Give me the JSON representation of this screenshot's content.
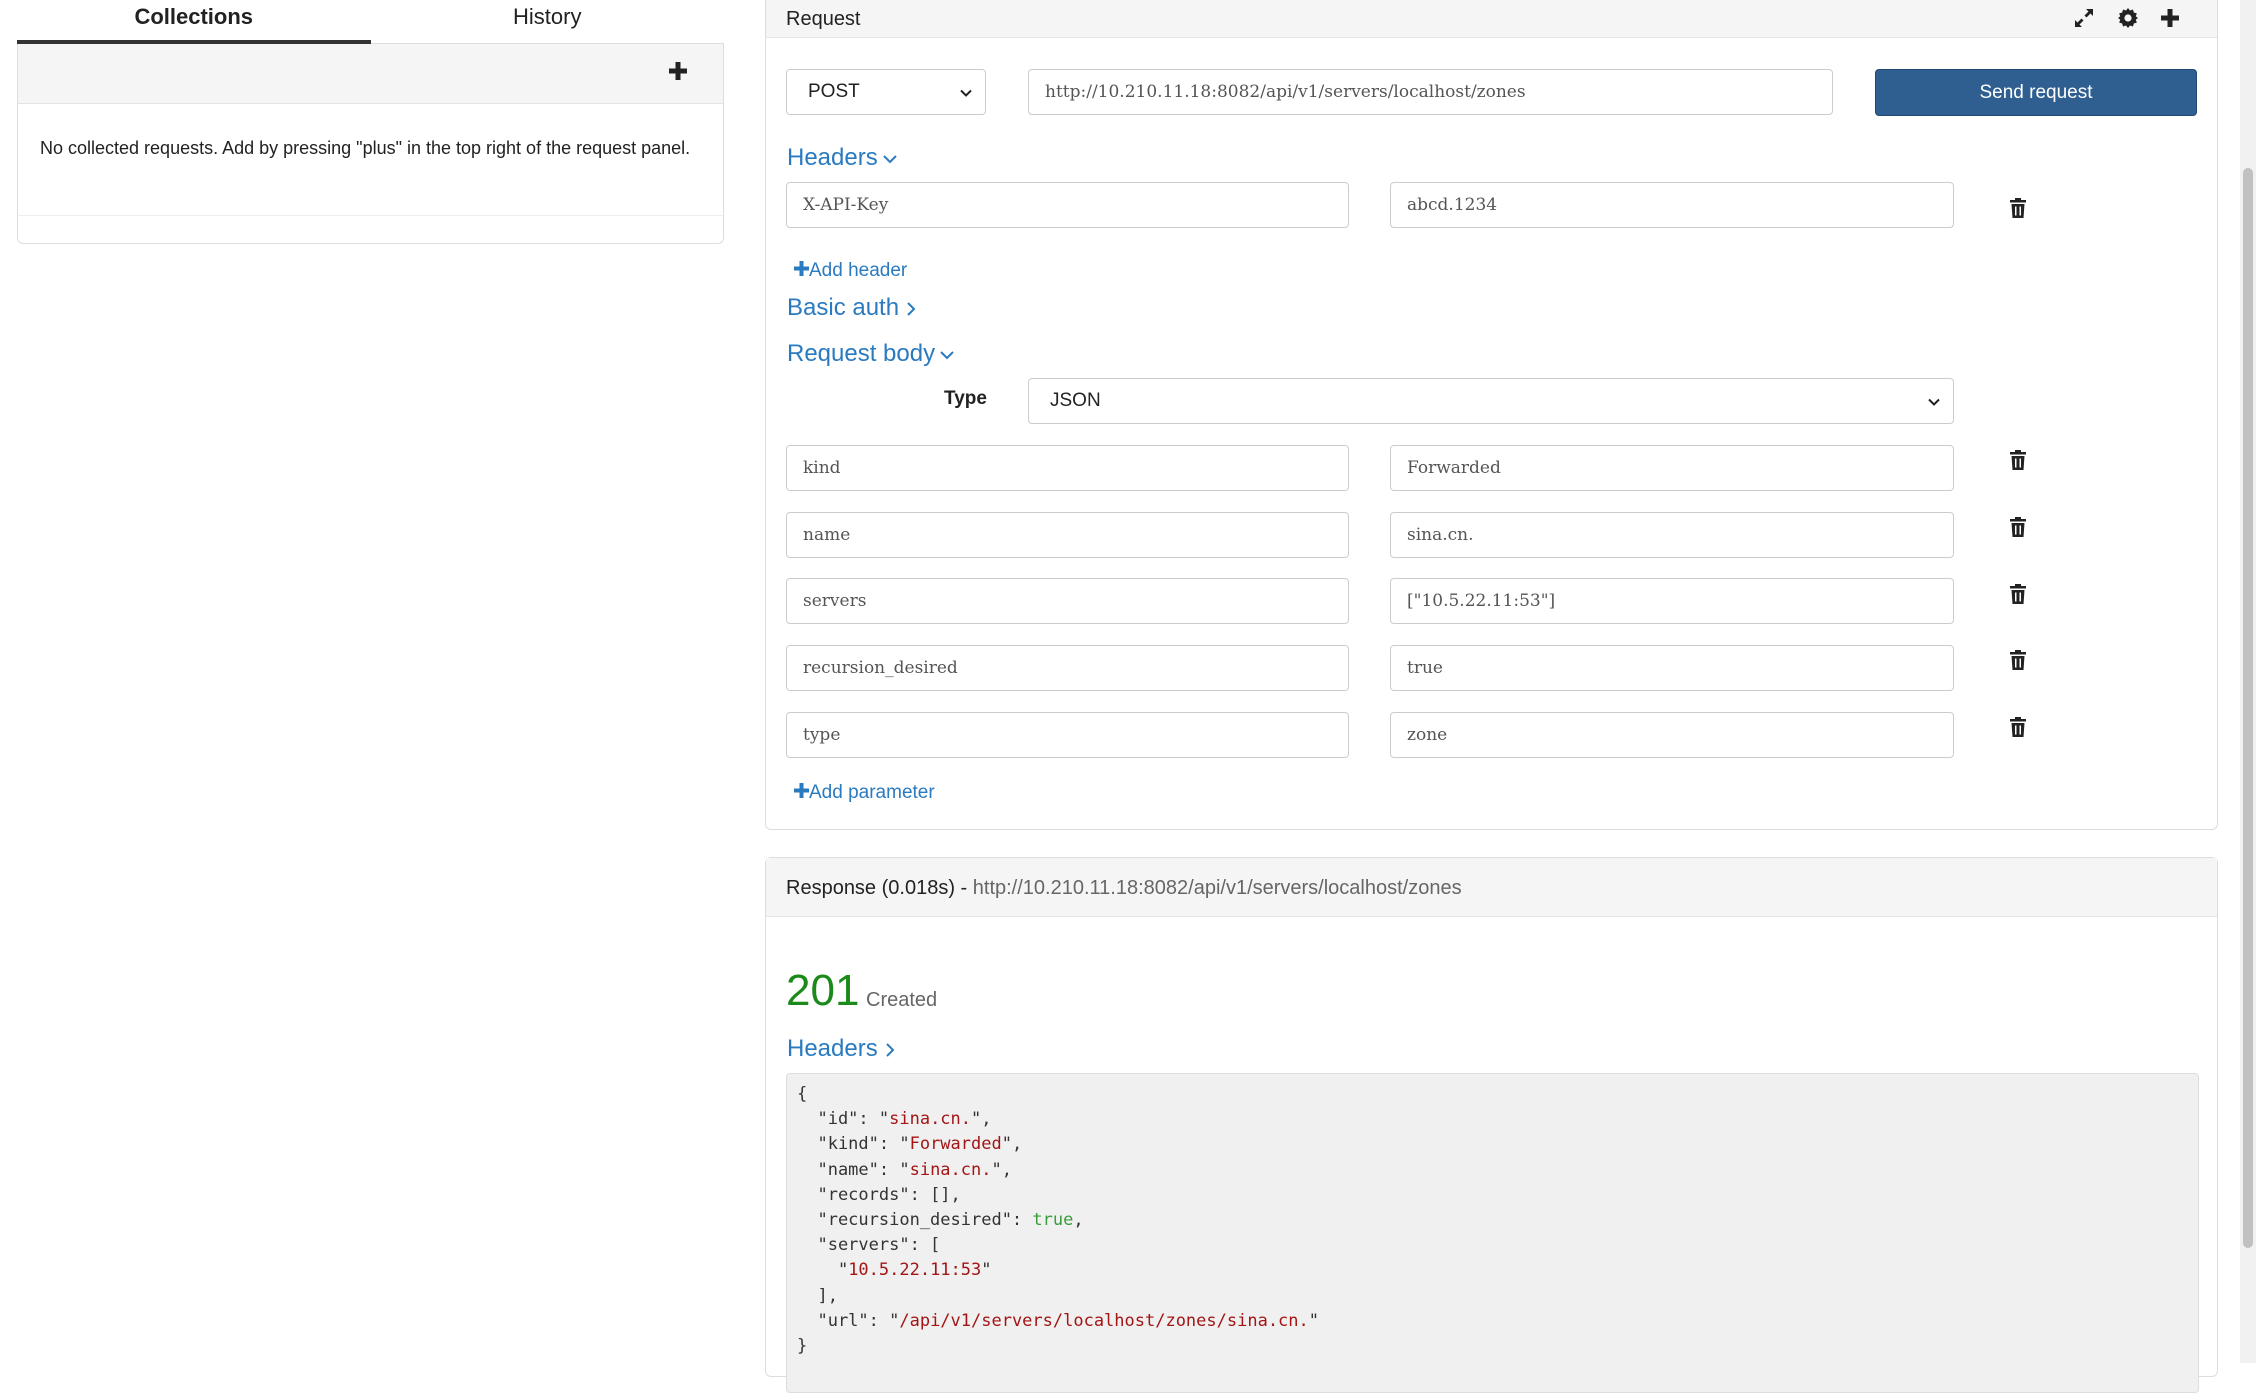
{
  "left": {
    "tabs": [
      "Collections",
      "History"
    ],
    "empty_message": "No collected requests. Add by pressing \"plus\" in the top right of the request panel."
  },
  "request": {
    "title": "Request",
    "method": "POST",
    "url": "http://10.210.11.18:8082/api/v1/servers/localhost/zones",
    "send_label": "Send request",
    "headers_title": "Headers",
    "headers": [
      {
        "key": "X-API-Key",
        "value": "abcd.1234"
      }
    ],
    "add_header_label": "Add header",
    "basic_auth_title": "Basic auth",
    "body_title": "Request body",
    "type_label": "Type",
    "type_value": "JSON",
    "params": [
      {
        "key": "kind",
        "value": "Forwarded"
      },
      {
        "key": "name",
        "value": "sina.cn."
      },
      {
        "key": "servers",
        "value": "[\"10.5.22.11:53\"]"
      },
      {
        "key": "recursion_desired",
        "value": "true"
      },
      {
        "key": "type",
        "value": "zone"
      }
    ],
    "add_param_label": "Add parameter"
  },
  "response": {
    "label": "Response (0.018s) -",
    "url": "http://10.210.11.18:8082/api/v1/servers/localhost/zones",
    "status_code": "201",
    "status_text": "Created",
    "headers_title": "Headers",
    "body": {
      "id": "sina.cn.",
      "kind": "Forwarded",
      "name": "sina.cn.",
      "records": "[]",
      "recursion_desired": "true",
      "server_0": "10.5.22.11:53",
      "url": "/api/v1/servers/localhost/zones/sina.cn."
    }
  },
  "colors": {
    "accent": "#2a7ac0",
    "send_button": "#2f5f91",
    "status_ok": "#1b8a1b"
  }
}
